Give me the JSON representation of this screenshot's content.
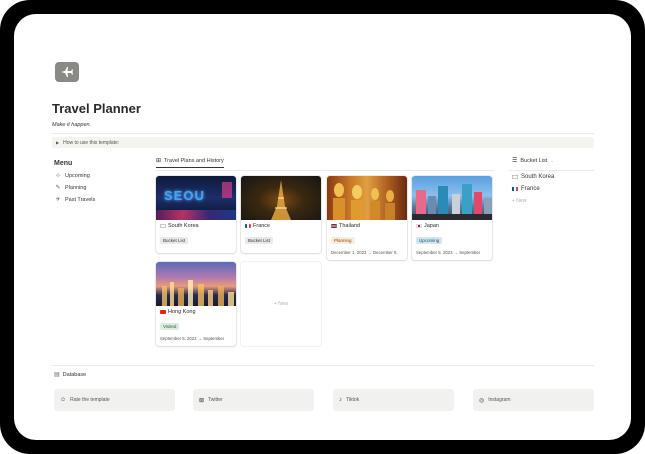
{
  "page": {
    "icon": "airplane-icon",
    "title": "Travel Planner",
    "subtitle": "Make it happen.",
    "toggle_label": "How to use this template:"
  },
  "menu": {
    "title": "Menu",
    "items": [
      {
        "label": "Upcoming",
        "icon": "signpost-icon"
      },
      {
        "label": "Planning",
        "icon": "pencil-icon"
      },
      {
        "label": "Past Travels",
        "icon": "plane-landing-icon"
      }
    ]
  },
  "gallery": {
    "view_label": "Travel Plans and History",
    "view_icon": "gallery-grid-icon",
    "cards": [
      {
        "name": "South Korea",
        "status": "Bucket List",
        "dates": ""
      },
      {
        "name": "France",
        "status": "Bucket List",
        "dates": ""
      },
      {
        "name": "Thailand",
        "status": "Planning",
        "dates": "December 1, 2023 → December 5,"
      },
      {
        "name": "Japan",
        "status": "Upcoming",
        "dates": "September 5, 2023 → September"
      },
      {
        "name": "Hong Kong",
        "status": "Visited",
        "dates": "September 5, 2022 → September"
      }
    ],
    "new_label": "+ New"
  },
  "bucket_list": {
    "view_label": "Bucket List",
    "items": [
      {
        "name": "South Korea"
      },
      {
        "name": "France"
      }
    ],
    "new_label": "+ New"
  },
  "database": {
    "label": "Database"
  },
  "links": [
    {
      "label": "Rate the template",
      "icon": "smile-icon"
    },
    {
      "label": "Twitter",
      "icon": "twitter-icon"
    },
    {
      "label": "Tiktok",
      "icon": "tiktok-icon"
    },
    {
      "label": "Instagram",
      "icon": "instagram-icon"
    }
  ],
  "colors": {
    "bucket_list_tag": "#e9e9e7",
    "planning_tag": "#fbecdd",
    "upcoming_tag": "#d3e5ef",
    "visited_tag": "#dbeddb"
  }
}
